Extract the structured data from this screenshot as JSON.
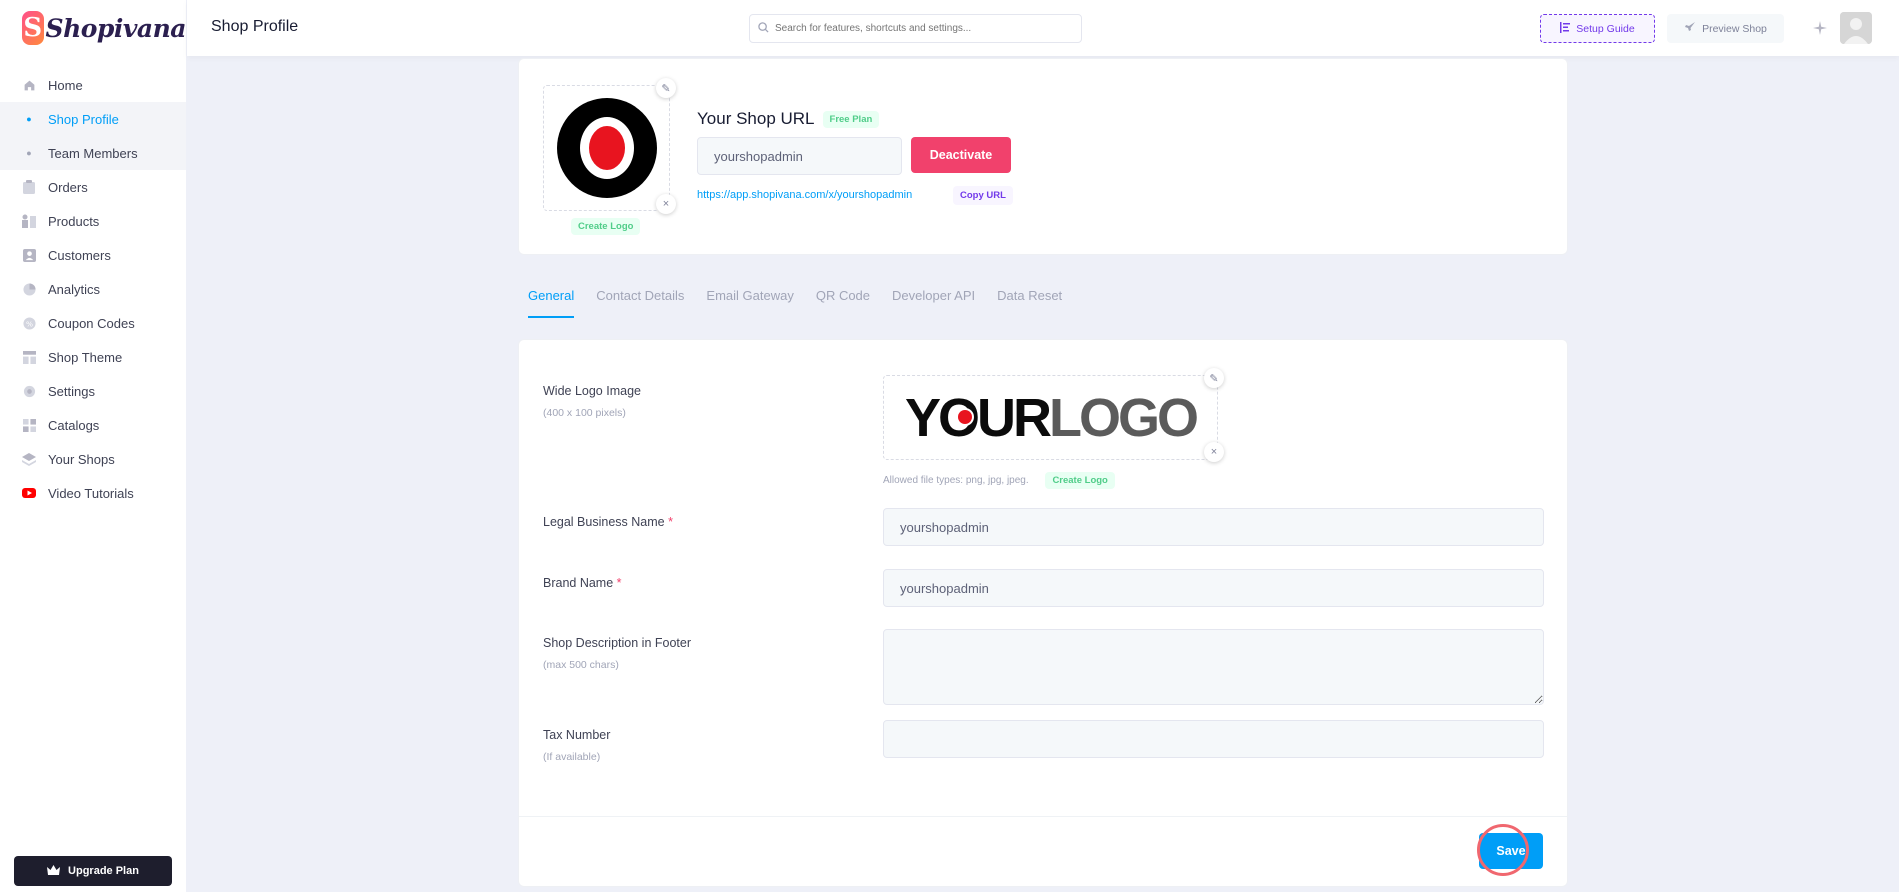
{
  "brand": {
    "mark": "S",
    "name": "Shopivana"
  },
  "sidebar": {
    "items": [
      {
        "label": "Home",
        "icon": "home-icon"
      },
      {
        "label": "Shop Profile",
        "icon": "dot-icon"
      },
      {
        "label": "Team Members",
        "icon": "dot-icon"
      },
      {
        "label": "Orders",
        "icon": "clipboard-icon"
      },
      {
        "label": "Products",
        "icon": "products-icon"
      },
      {
        "label": "Customers",
        "icon": "customers-icon"
      },
      {
        "label": "Analytics",
        "icon": "pie-chart-icon"
      },
      {
        "label": "Coupon Codes",
        "icon": "coupon-icon"
      },
      {
        "label": "Shop Theme",
        "icon": "theme-icon"
      },
      {
        "label": "Settings",
        "icon": "gear-icon"
      },
      {
        "label": "Catalogs",
        "icon": "catalog-icon"
      },
      {
        "label": "Your Shops",
        "icon": "layers-icon"
      },
      {
        "label": "Video Tutorials",
        "icon": "youtube-icon"
      }
    ],
    "upgrade_label": "Upgrade Plan"
  },
  "header": {
    "title": "Shop Profile",
    "search_placeholder": "Search for features, shortcuts and settings...",
    "setup_guide": "Setup Guide",
    "preview_shop": "Preview Shop"
  },
  "shop": {
    "url_title": "Your Shop URL",
    "plan_badge": "Free Plan",
    "slug": "yourshopadmin",
    "deactivate": "Deactivate",
    "link": "https://app.shopivana.com/x/yourshopadmin",
    "copy_url": "Copy URL",
    "create_logo": "Create Logo"
  },
  "tabs": [
    "General",
    "Contact Details",
    "Email Gateway",
    "QR Code",
    "Developer API",
    "Data Reset"
  ],
  "form": {
    "wide_logo_label": "Wide Logo Image",
    "wide_logo_hint": "(400 x 100 pixels)",
    "logo_text_dark": "YOUR",
    "logo_text_grey": "LOGO",
    "allowed_types": "Allowed file types: png, jpg, jpeg.",
    "create_logo": "Create Logo",
    "legal_name_label": "Legal Business Name",
    "legal_name_value": "yourshopadmin",
    "brand_name_label": "Brand Name",
    "brand_name_value": "yourshopadmin",
    "required_mark": "*",
    "description_label": "Shop Description in Footer",
    "description_hint": "(max 500 chars)",
    "description_value": "",
    "tax_label": "Tax Number",
    "tax_hint": "(If available)",
    "tax_value": "",
    "save": "Save"
  },
  "colors": {
    "primary": "#009ef7",
    "danger": "#f1416c",
    "success": "#50cd89",
    "purple": "#7239ea",
    "dark": "#1e1e2d"
  }
}
